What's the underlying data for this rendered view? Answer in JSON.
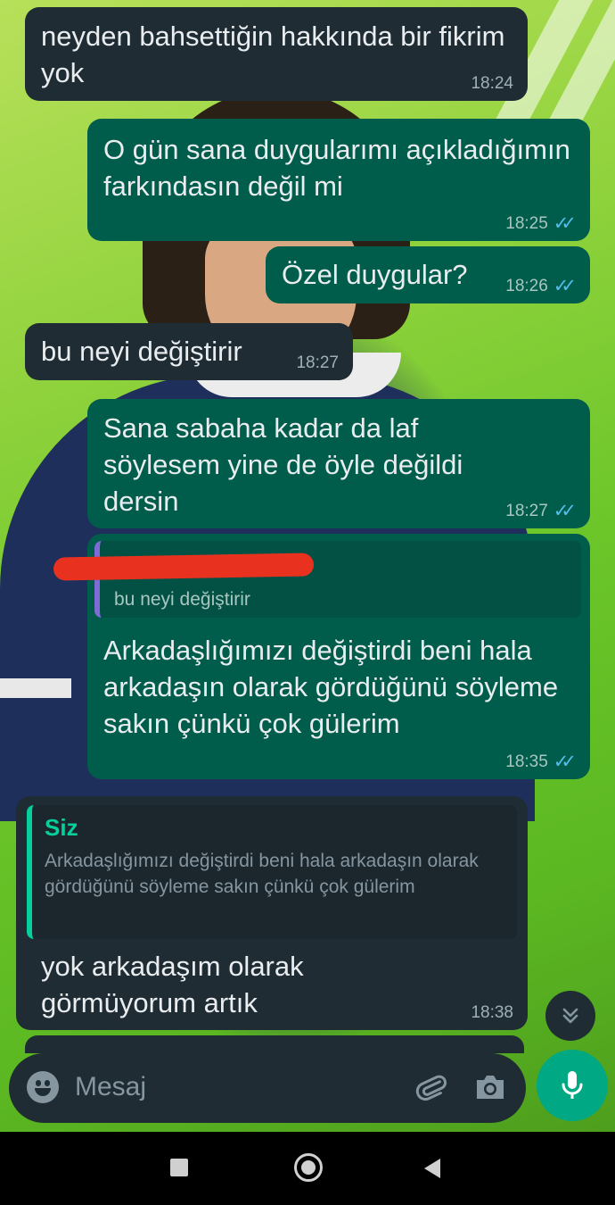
{
  "messages": [
    {
      "direction": "in",
      "text": "neyden bahsettiğin hakkında bir fikrim yok",
      "time": "18:24"
    },
    {
      "direction": "out",
      "text": "O gün sana duygularımı açıkladığımın farkındasın değil mi",
      "time": "18:25"
    },
    {
      "direction": "out",
      "text": "Özel duygular?",
      "time": "18:26"
    },
    {
      "direction": "in",
      "text": "bu neyi değiştirir",
      "time": "18:27"
    },
    {
      "direction": "out",
      "text": "Sana sabaha kadar da laf söylesem yine de öyle değildi dersin",
      "time": "18:27"
    },
    {
      "direction": "out",
      "reply_to_text": "bu neyi değiştirir",
      "text": "Arkadaşlığımızı değiştirdi beni hala arkadaşın olarak gördüğünü söyleme sakın çünkü çok gülerim",
      "time": "18:35"
    },
    {
      "direction": "in",
      "reply_to_author": "Siz",
      "reply_to_text": "Arkadaşlığımızı değiştirdi beni hala arkadaşın olarak gördüğünü söyleme sakın çünkü çok gülerim",
      "text": "yok arkadaşım olarak görmüyorum artık",
      "time": "18:38"
    }
  ],
  "composer": {
    "placeholder": "Mesaj"
  },
  "colors": {
    "incoming_bubble": "#1f2c34",
    "outgoing_bubble": "#005c4b",
    "read_ticks": "#53bdeb",
    "accent_green": "#00a884",
    "quote_author": "#06cf9c",
    "redaction": "#e8321f"
  },
  "icons": {
    "read_receipt": "double-check-icon",
    "scroll_down": "chevron-double-down-icon",
    "emoji": "emoji-icon",
    "attach": "paperclip-icon",
    "camera": "camera-icon",
    "mic": "mic-icon"
  }
}
